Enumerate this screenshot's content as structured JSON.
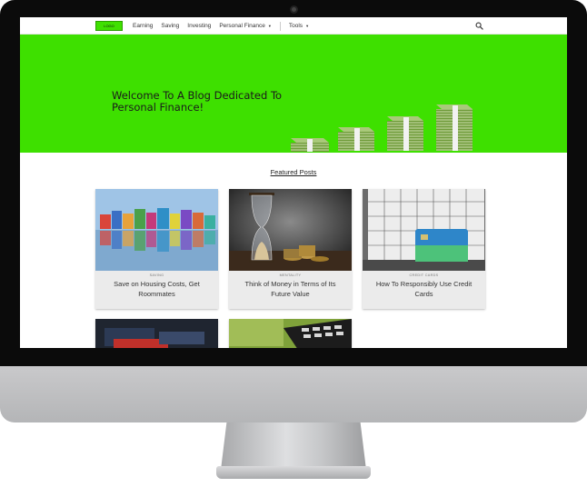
{
  "nav": {
    "logo": "LOGO",
    "links": [
      "Earning",
      "Saving",
      "Investing"
    ],
    "personal_finance": "Personal Finance",
    "tools": "Tools",
    "search_icon": "search-icon"
  },
  "hero": {
    "title": "Welcome To A Blog Dedicated To Personal Finance!",
    "background": "#3ee000"
  },
  "featured": {
    "heading": "Featured Posts",
    "posts": [
      {
        "category": "SAVING",
        "title": "Save on Housing Costs, Get Roommates"
      },
      {
        "category": "MENTALITY",
        "title": "Think of Money in Terms of Its Future Value"
      },
      {
        "category": "CREDIT CARDS",
        "title": "How To Responsibly Use Credit Cards"
      },
      {
        "category": "",
        "title": ""
      },
      {
        "category": "",
        "title": ""
      }
    ]
  },
  "colors": {
    "accent": "#3ee000",
    "card_bg": "#ebebeb",
    "bezel": "#0b0b0b"
  }
}
